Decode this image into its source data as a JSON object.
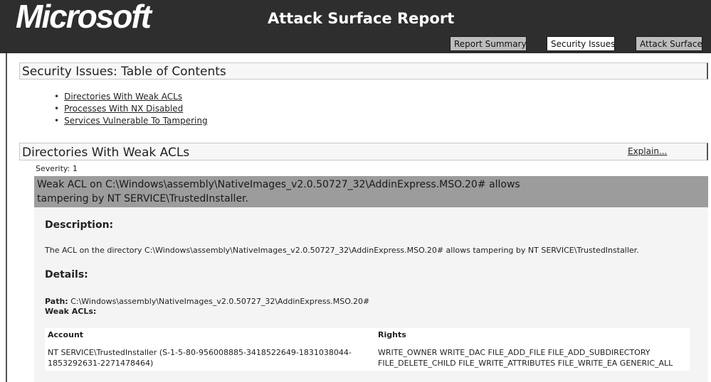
{
  "header": {
    "logo": "Microsoft",
    "title": "Attack Surface Report",
    "tabs": [
      {
        "label": "Report Summary",
        "active": false
      },
      {
        "label": "Security Issues",
        "active": true
      },
      {
        "label": "Attack Surface",
        "active": false
      }
    ]
  },
  "toc": {
    "heading": "Security Issues: Table of Contents",
    "links": [
      "Directories With Weak ACLs",
      "Processes With NX Disabled",
      "Services Vulnerable To Tampering"
    ]
  },
  "section": {
    "heading": "Directories With Weak ACLs",
    "explain_link": "Explain...",
    "severity": "Severity: 1",
    "issue_title": "Weak ACL on C:\\Windows\\assembly\\NativeImages_v2.0.50727_32\\AddinExpress.MSO.20# allows tampering by NT SERVICE\\TrustedInstaller.",
    "description_heading": "Description:",
    "description_text": "The ACL on the directory C:\\Windows\\assembly\\NativeImages_v2.0.50727_32\\AddinExpress.MSO.20# allows tampering by NT SERVICE\\TrustedInstaller.",
    "details_heading": "Details:",
    "path_label": "Path:",
    "path_value": "C:\\Windows\\assembly\\NativeImages_v2.0.50727_32\\AddinExpress.MSO.20#",
    "weak_acls_label": "Weak ACLs:",
    "table": {
      "columns": [
        "Account",
        "Rights"
      ],
      "rows": [
        {
          "account": "NT SERVICE\\TrustedInstaller (S-1-5-80-956008885-3418522649-1831038044-1853292631-2271478464)",
          "rights": "WRITE_OWNER WRITE_DAC FILE_ADD_FILE FILE_ADD_SUBDIRECTORY FILE_DELETE_CHILD FILE_WRITE_ATTRIBUTES FILE_WRITE_EA GENERIC_ALL"
        }
      ]
    }
  }
}
